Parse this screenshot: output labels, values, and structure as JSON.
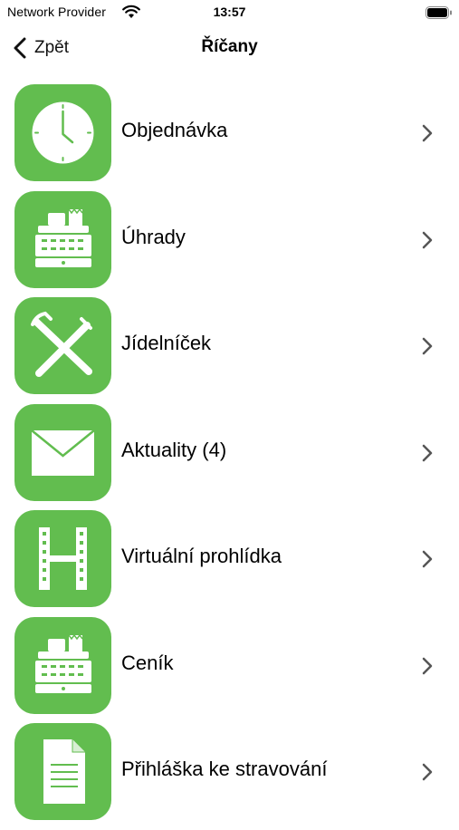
{
  "status": {
    "carrier": "Network Provider",
    "time": "13:57"
  },
  "nav": {
    "back_label": "Zpět",
    "title": "Říčany"
  },
  "menu": [
    {
      "label": "Objednávka",
      "icon": "clock-icon"
    },
    {
      "label": "Úhrady",
      "icon": "cash-register-icon"
    },
    {
      "label": "Jídelníček",
      "icon": "fork-knife-icon"
    },
    {
      "label": "Aktuality (4)",
      "icon": "envelope-icon"
    },
    {
      "label": "Virtuální prohlídka",
      "icon": "film-strip-icon"
    },
    {
      "label": "Ceník",
      "icon": "cash-register-icon"
    },
    {
      "label": "Přihláška ke stravování",
      "icon": "document-icon"
    }
  ],
  "colors": {
    "accent": "#62bd4f",
    "icon_foreground": "#ffffff",
    "chevron": "#555555"
  }
}
